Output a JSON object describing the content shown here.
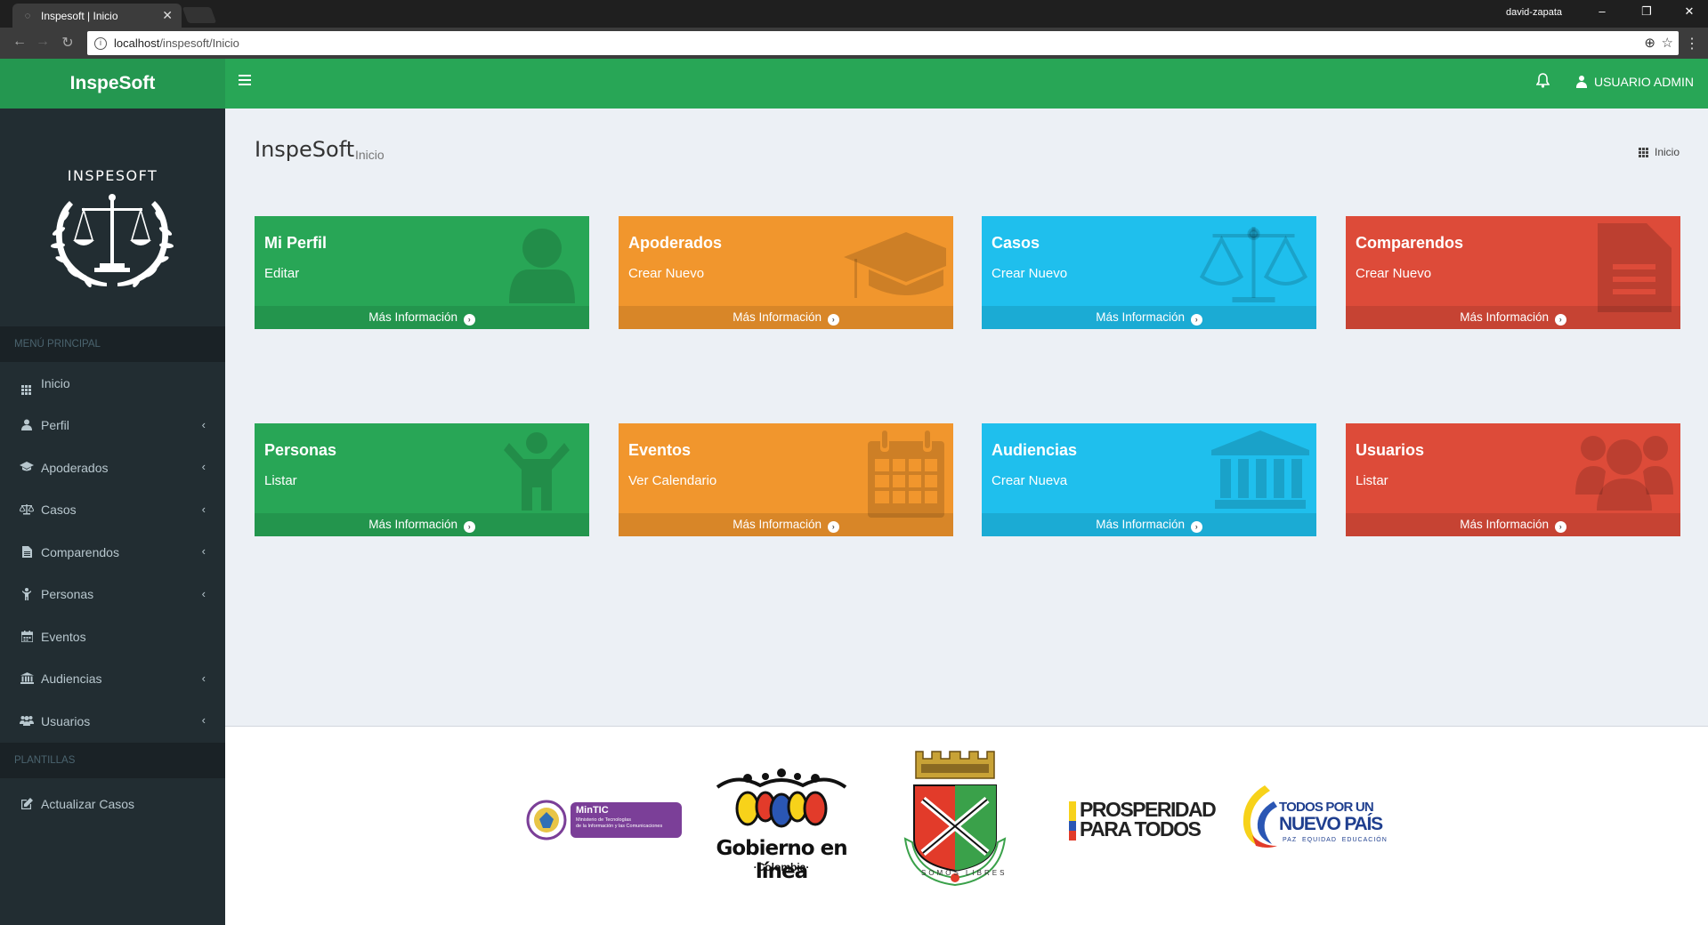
{
  "browser": {
    "tab_title": "Inspesoft | Inicio",
    "profile": "david-zapata",
    "url_host": "localhost",
    "url_path": "/inspesoft/Inicio"
  },
  "header": {
    "logo": "InspeSoft",
    "user": "USUARIO ADMIN"
  },
  "sidebar": {
    "brand": "INSPESOFT",
    "section_main": "MENÚ PRINCIPAL",
    "items": [
      {
        "label": "Inicio",
        "icon": "th-icon"
      },
      {
        "label": "Perfil",
        "icon": "user-icon"
      },
      {
        "label": "Apoderados",
        "icon": "graduation-cap-icon"
      },
      {
        "label": "Casos",
        "icon": "balance-scale-icon"
      },
      {
        "label": "Comparendos",
        "icon": "file-text-icon"
      },
      {
        "label": "Personas",
        "icon": "child-icon"
      },
      {
        "label": "Eventos",
        "icon": "calendar-icon"
      },
      {
        "label": "Audiencias",
        "icon": "bank-icon"
      },
      {
        "label": "Usuarios",
        "icon": "users-icon"
      }
    ],
    "section_templates": "PLANTILLAS",
    "template_items": [
      {
        "label": "Actualizar Casos",
        "icon": "edit-icon"
      }
    ]
  },
  "content": {
    "title": "InspeSoft",
    "subtitle": "Inicio",
    "breadcrumb": "Inicio",
    "more_info": "Más Información",
    "boxes": [
      {
        "title": "Mi Perfil",
        "sub": "Editar",
        "color": "#28a656",
        "icon": "user-icon"
      },
      {
        "title": "Apoderados",
        "sub": "Crear Nuevo",
        "color": "#f1962d",
        "icon": "graduation-cap-icon"
      },
      {
        "title": "Casos",
        "sub": "Crear Nuevo",
        "color": "#1fbfed",
        "icon": "balance-scale-icon"
      },
      {
        "title": "Comparendos",
        "sub": "Crear Nuevo",
        "color": "#dd4b39",
        "icon": "file-text-icon"
      },
      {
        "title": "Personas",
        "sub": "Listar",
        "color": "#28a656",
        "icon": "child-icon"
      },
      {
        "title": "Eventos",
        "sub": "Ver Calendario",
        "color": "#f1962d",
        "icon": "calendar-icon"
      },
      {
        "title": "Audiencias",
        "sub": "Crear Nueva",
        "color": "#1fbfed",
        "icon": "bank-icon"
      },
      {
        "title": "Usuarios",
        "sub": "Listar",
        "color": "#dd4b39",
        "icon": "users-icon"
      }
    ]
  },
  "footer": {
    "mintic": "MinTIC",
    "mintic_sub1": "Ministerio de Tecnologías",
    "mintic_sub2": "de la Información y las Comunicaciones",
    "gel_line1": "Gobierno en línea",
    "gel_line2": "·Colombia·",
    "shield_motto": "SOMOS LIBRES",
    "prosperidad_1": "PROSPERIDAD",
    "prosperidad_2": "PARA TODOS",
    "npais_1": "TODOS POR UN",
    "npais_2": "NUEVO PAÍS",
    "npais_3": "PAZ  EQUIDAD  EDUCACIÓN"
  }
}
